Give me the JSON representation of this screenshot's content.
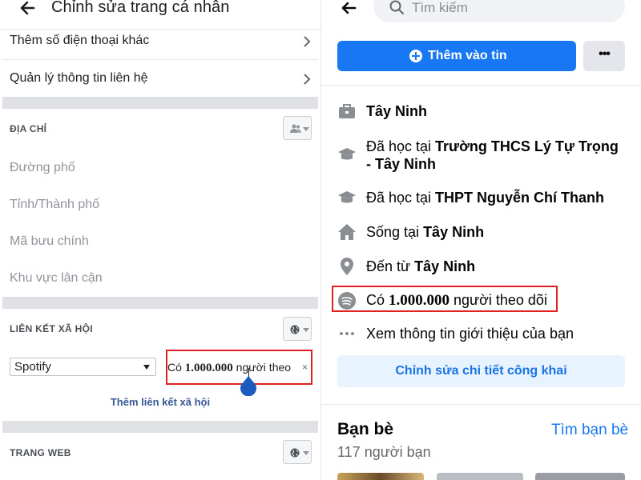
{
  "left": {
    "header": {
      "title": "Chỉnh sửa trang cá nhân",
      "back_icon": "back-arrow-icon"
    },
    "contact_rows": [
      {
        "label": "Thêm số điện thoại khác",
        "icon": "chevron-right-icon"
      },
      {
        "label": "Quản lý thông tin liên hệ",
        "icon": "chevron-right-icon"
      }
    ],
    "address": {
      "section_title": "ĐỊA CHỈ",
      "privacy_icon": "friends-icon",
      "fields": [
        "Đường phố",
        "Tỉnh/Thành phố",
        "Mã bưu chính",
        "Khu vực lân cận"
      ]
    },
    "social": {
      "section_title": "LIÊN KẾT XÃ HỘI",
      "privacy_icon": "globe-icon",
      "service_selected": "Spotify",
      "link_prefix": "Có ",
      "link_number": "1.000.000",
      "link_suffix": " người theo",
      "clear_symbol": "×",
      "add_link_label": "Thêm liên kết xã hội"
    },
    "website": {
      "section_title": "TRANG WEB",
      "privacy_icon": "globe-icon"
    }
  },
  "right": {
    "search_placeholder": "Tìm kiếm",
    "add_story_label": "Thêm vào tin",
    "more_label": "•••",
    "intro_items": [
      {
        "icon": "briefcase-icon",
        "prefix": "",
        "bold": "Tây Ninh",
        "suffix": ""
      },
      {
        "icon": "graduation-cap-icon",
        "prefix": "Đã học tại ",
        "bold": "Trường THCS Lý Tự Trọng",
        "suffix": "",
        "line2": "- Tây Ninh"
      },
      {
        "icon": "graduation-cap-icon",
        "prefix": "Đã học tại ",
        "bold": "THPT Nguyễn Chí Thanh",
        "suffix": ""
      },
      {
        "icon": "home-icon",
        "prefix": "Sống tại ",
        "bold": "Tây Ninh",
        "suffix": ""
      },
      {
        "icon": "location-pin-icon",
        "prefix": "Đến từ ",
        "bold": "Tây Ninh",
        "suffix": ""
      },
      {
        "icon": "spotify-icon",
        "prefix": "Có ",
        "bold": "1.000.000",
        "suffix": " người theo dõi"
      },
      {
        "icon": "more-dots-icon",
        "prefix": "Xem thông tin giới thiệu của bạn",
        "bold": "",
        "suffix": ""
      }
    ],
    "edit_details_label": "Chỉnh sửa chi tiết công khai",
    "friends": {
      "title": "Bạn bè",
      "find_label": "Tìm bạn bè",
      "count_label": "117 người bạn"
    }
  },
  "colors": {
    "highlight_red": "#e0211f",
    "fb_blue": "#1877f2",
    "link_blue": "#385898"
  }
}
